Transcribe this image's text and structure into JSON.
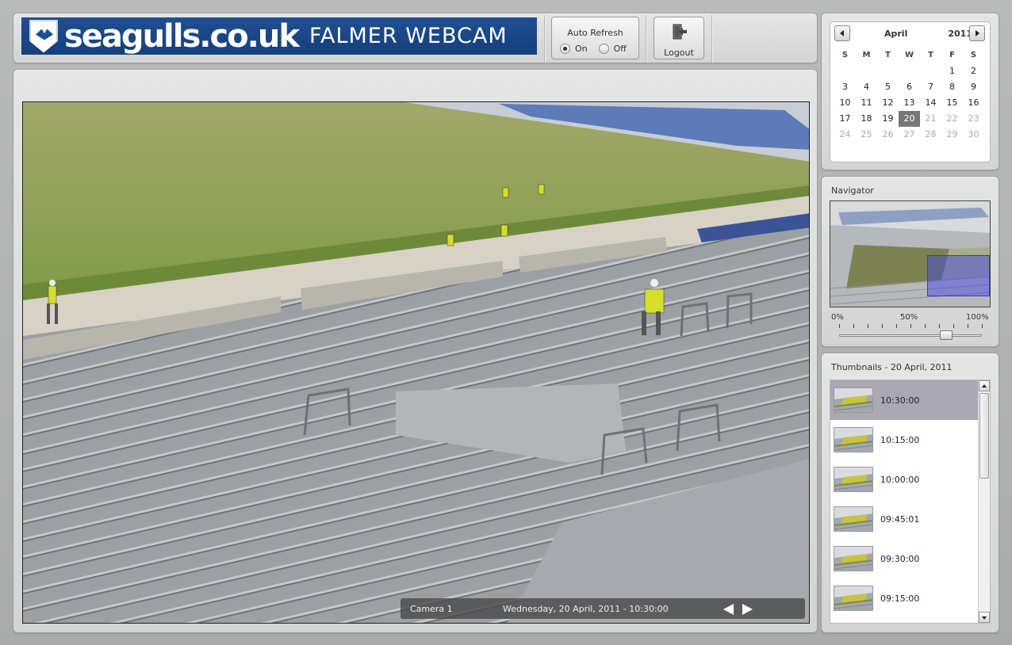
{
  "header": {
    "brand_main": "seagulls.co.uk",
    "brand_sub": "FALMER WEBCAM",
    "auto_refresh": {
      "title": "Auto Refresh",
      "on_label": "On",
      "off_label": "Off",
      "selected": "On"
    },
    "logout_label": "Logout"
  },
  "viewer": {
    "camera_label": "Camera 1",
    "timestamp": "Wednesday, 20 April, 2011 - 10:30:00"
  },
  "calendar": {
    "month": "April",
    "year": "2011",
    "weekdays": [
      "S",
      "M",
      "T",
      "W",
      "T",
      "F",
      "S"
    ],
    "selected_day": "20",
    "weeks": [
      [
        "",
        "",
        "",
        "",
        "",
        "1",
        "2"
      ],
      [
        "3",
        "4",
        "5",
        "6",
        "7",
        "8",
        "9"
      ],
      [
        "10",
        "11",
        "12",
        "13",
        "14",
        "15",
        "16"
      ],
      [
        "17",
        "18",
        "19",
        "20",
        "21",
        "22",
        "23"
      ],
      [
        "24",
        "25",
        "26",
        "27",
        "28",
        "29",
        "30"
      ]
    ],
    "disabled_after": 20
  },
  "navigator": {
    "title": "Navigator",
    "zoom_labels": [
      "0%",
      "50%",
      "100%"
    ],
    "zoom_value": 0.75
  },
  "thumbnails": {
    "title": "Thumbnails - 20 April, 2011",
    "selected": "10:30:00",
    "items": [
      "10:30:00",
      "10:15:00",
      "10:00:00",
      "09:45:01",
      "09:30:00",
      "09:15:00"
    ]
  },
  "colors": {
    "brand_blue": "#1f4f93",
    "selected_day": "#777777",
    "selected_thumb": "#aaa8b2",
    "nav_selection": "#3838d0"
  }
}
